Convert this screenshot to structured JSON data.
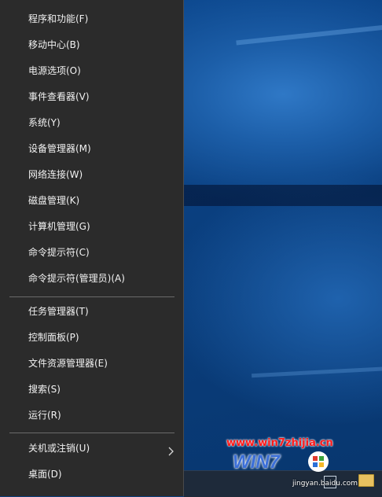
{
  "menu": {
    "items": [
      {
        "label": "程序和功能(F)"
      },
      {
        "label": "移动中心(B)"
      },
      {
        "label": "电源选项(O)"
      },
      {
        "label": "事件查看器(V)"
      },
      {
        "label": "系统(Y)"
      },
      {
        "label": "设备管理器(M)"
      },
      {
        "label": "网络连接(W)"
      },
      {
        "label": "磁盘管理(K)"
      },
      {
        "label": "计算机管理(G)"
      },
      {
        "label": "命令提示符(C)"
      },
      {
        "label": "命令提示符(管理员)(A)"
      },
      {
        "label": "任务管理器(T)"
      },
      {
        "label": "控制面板(P)"
      },
      {
        "label": "文件资源管理器(E)"
      },
      {
        "label": "搜索(S)"
      },
      {
        "label": "运行(R)"
      },
      {
        "label": "关机或注销(U)"
      },
      {
        "label": "桌面(D)"
      }
    ],
    "submenu_icon": "chevron-right-icon"
  },
  "watermark": {
    "url": "www.win7zhijia.cn",
    "logo_text": "WIN7",
    "sub_text": "jingyan.baidu.com"
  },
  "colors": {
    "menu_bg": "#2b2b2b",
    "menu_text": "#f2f2f2",
    "desktop_bg": "#0b3f7e",
    "watermark_red": "#ff1a1a"
  }
}
